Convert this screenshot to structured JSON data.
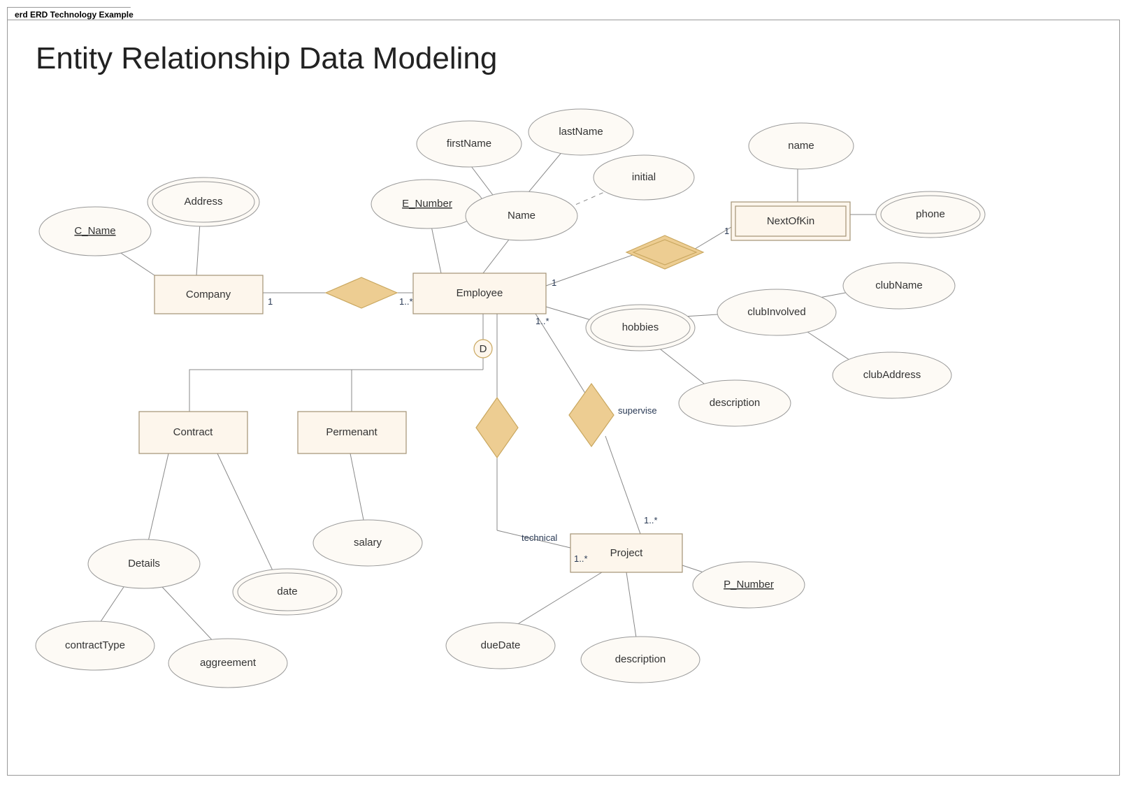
{
  "frame": {
    "tab": "erd ERD Technology Example"
  },
  "title": "Entity Relationship Data Modeling",
  "entities": {
    "company": "Company",
    "employee": "Employee",
    "nextofkin": "NextOfKin",
    "contract": "Contract",
    "permanent": "Permenant",
    "project": "Project"
  },
  "attributes": {
    "c_name": {
      "label": "C_Name",
      "pk": true
    },
    "address": {
      "label": "Address",
      "multi": true
    },
    "e_number": {
      "label": "E_Number",
      "pk": true
    },
    "name_comp": {
      "label": "Name"
    },
    "first_name": {
      "label": "firstName"
    },
    "last_name": {
      "label": "lastName"
    },
    "initial": {
      "label": "initial"
    },
    "hobbies": {
      "label": "hobbies",
      "multi": true
    },
    "club_inv": {
      "label": "clubInvolved"
    },
    "club_name": {
      "label": "clubName"
    },
    "club_addr": {
      "label": "clubAddress"
    },
    "descr_hob": {
      "label": "description"
    },
    "nok_name": {
      "label": "name"
    },
    "nok_phone": {
      "label": "phone",
      "multi": true
    },
    "details": {
      "label": "Details"
    },
    "contract_t": {
      "label": "contractType"
    },
    "aggreement": {
      "label": "aggreement"
    },
    "date": {
      "label": "date",
      "multi": true
    },
    "salary": {
      "label": "salary"
    },
    "p_number": {
      "label": "P_Number",
      "pk": true
    },
    "due_date": {
      "label": "dueDate"
    },
    "descr_proj": {
      "label": "description"
    }
  },
  "relationships": {
    "supervise": "supervise",
    "technical": "technical"
  },
  "indicator": {
    "d": "D"
  },
  "cardinalities": {
    "company_side": "1",
    "employee_left": "1..*",
    "employee_right": "1",
    "nextofkin_side": "1",
    "emp_down": "1..*",
    "proj_sup": "1..*",
    "proj_tech": "1..*"
  }
}
